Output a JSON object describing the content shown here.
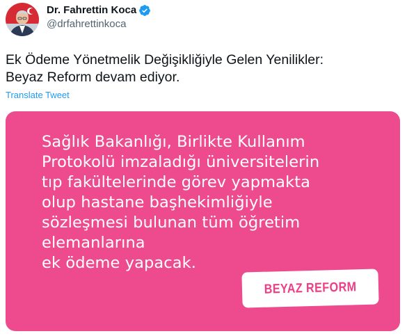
{
  "author": {
    "display_name": "Dr. Fahrettin Koca",
    "handle": "@drfahrettinkoca",
    "avatar_icon": "profile-photo",
    "verified_icon": "verified-badge-icon",
    "verified_color": "#1d9bf0"
  },
  "tweet": {
    "text": "Ek Ödeme Yönetmelik Değişikliğiyle Gelen Yenilikler:\nBeyaz Reform devam ediyor.",
    "translate_label": "Translate Tweet"
  },
  "media": {
    "background_color": "#ee4b8f",
    "text": "Sağlık Bakanlığı, Birlikte Kullanım\nProtokolü imzaladığı üniversitelerin\ntıp fakültelerinde görev yapmakta\nolup hastane başhekimliğiyle\nsözleşmesi bulunan tüm öğretim\nelemanlarına\nek ödeme yapacak.",
    "badge_label": "BEYAZ REFORM"
  },
  "colors": {
    "text_primary": "#0f1419",
    "text_secondary": "#536471",
    "link": "#1d9bf0"
  }
}
